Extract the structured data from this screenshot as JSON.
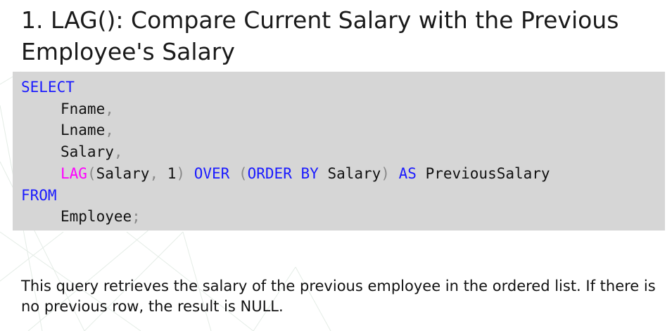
{
  "slide": {
    "title": "1. LAG(): Compare Current Salary with the Previous Employee's Salary",
    "code": {
      "select_kw": "SELECT",
      "fname": "Fname",
      "comma": ",",
      "lname": "Lname",
      "salary": "Salary",
      "lag_fn": "LAG",
      "open_paren": "(",
      "close_paren": ")",
      "lag_args_salary": "Salary",
      "lag_offset": "1",
      "over_kw": "OVER",
      "order_by_kw": "ORDER BY",
      "order_col": "Salary",
      "as_kw": "AS",
      "alias": "PreviousSalary",
      "from_kw": "FROM",
      "table": "Employee",
      "semicolon": ";"
    },
    "description": "This query retrieves the salary of the previous employee in the ordered list. If there is no previous row, the result is NULL."
  }
}
